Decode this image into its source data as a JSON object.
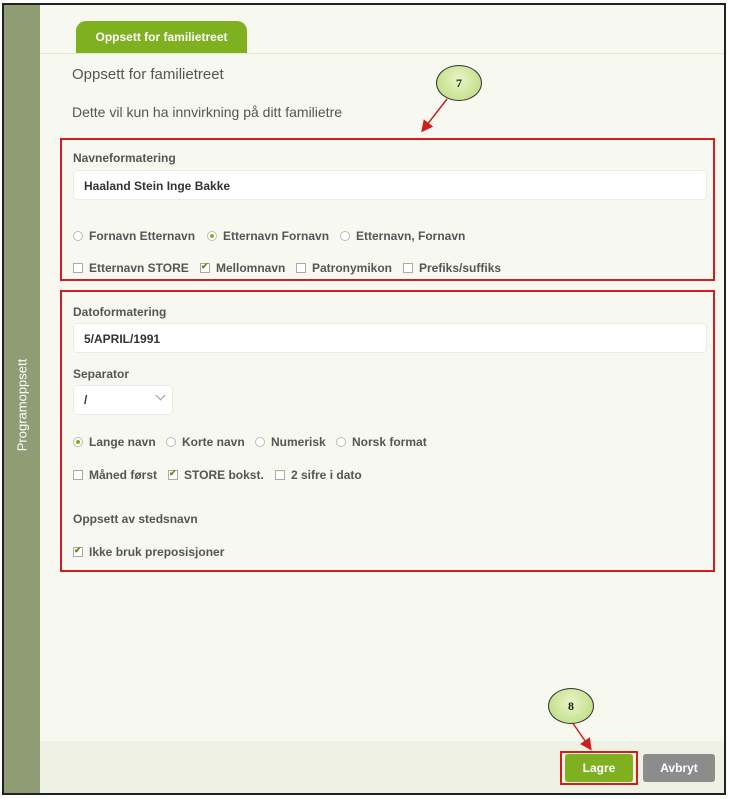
{
  "sidebar": {
    "label": "Programoppsett"
  },
  "tab": {
    "label": "Oppsett for familietreet"
  },
  "page": {
    "heading": "Oppsett for familietreet",
    "subheading": "Dette vil kun ha innvirkning på ditt familietre"
  },
  "name_format": {
    "label": "Navneformatering",
    "preview": "Haaland Stein Inge Bakke",
    "order_options": [
      "Fornavn Etternavn",
      "Etternavn Fornavn",
      "Etternavn, Fornavn"
    ],
    "order_selected": "Etternavn Fornavn",
    "checkboxes": [
      {
        "label": "Etternavn STORE",
        "checked": false
      },
      {
        "label": "Mellomnavn",
        "checked": true
      },
      {
        "label": "Patronymikon",
        "checked": false
      },
      {
        "label": "Prefiks/suffiks",
        "checked": false
      }
    ]
  },
  "date_format": {
    "label": "Datoformatering",
    "preview": "5/APRIL/1991",
    "separator_label": "Separator",
    "separator_value": "/",
    "month_options": [
      "Lange navn",
      "Korte navn",
      "Numerisk",
      "Norsk format"
    ],
    "month_selected": "Lange navn",
    "checkboxes": [
      {
        "label": "Måned først",
        "checked": false
      },
      {
        "label": "STORE bokst.",
        "checked": true
      },
      {
        "label": "2 sifre i dato",
        "checked": false
      }
    ]
  },
  "place_names": {
    "label": "Oppsett av stedsnavn",
    "checkbox": {
      "label": "Ikke bruk preposisjoner",
      "checked": true
    }
  },
  "footer": {
    "save_label": "Lagre",
    "cancel_label": "Avbryt"
  },
  "callouts": [
    "7",
    "8"
  ],
  "colors": {
    "accent": "#7fb020",
    "sidebar": "#8f9c74",
    "highlight": "#d01e1e",
    "cancel": "#8c8c8c"
  }
}
